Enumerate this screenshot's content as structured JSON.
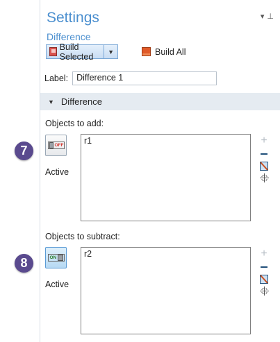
{
  "settings": {
    "title": "Settings",
    "node": "Difference",
    "build_selected_label": "Build Selected",
    "build_all_label": "Build All"
  },
  "label_field": {
    "label": "Label:",
    "value": "Difference 1"
  },
  "section": {
    "title": "Difference"
  },
  "objects_to_add": {
    "label": "Objects to add:",
    "toggle_text": "OFF",
    "active_label": "Active",
    "items": [
      "r1"
    ],
    "badge": "7"
  },
  "objects_to_subtract": {
    "label": "Objects to subtract:",
    "toggle_text": "ON",
    "active_label": "Active",
    "items": [
      "r2"
    ],
    "badge": "8"
  },
  "colors": {
    "accent": "#4b8fcf",
    "badge": "#5a4a8e",
    "section_bg": "#e5ebf1"
  }
}
